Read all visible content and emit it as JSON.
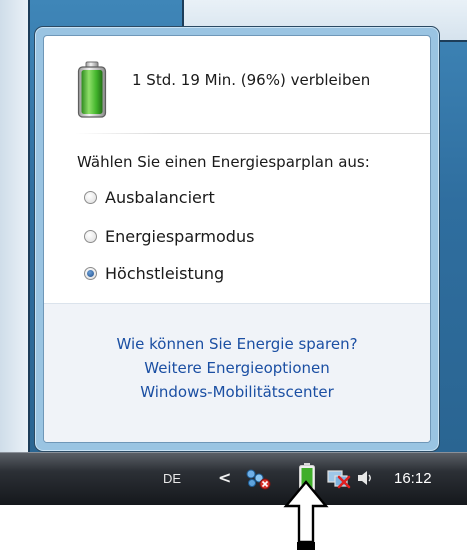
{
  "flyout": {
    "status_text": "1 Std. 19 Min. (96%) verbleiben",
    "battery_percent": 96,
    "plan_title": "Wählen Sie einen Energiesparplan aus:",
    "plans": [
      {
        "label": "Ausbalanciert",
        "selected": false
      },
      {
        "label": "Energiesparmodus",
        "selected": false
      },
      {
        "label": "Höchstleistung",
        "selected": true
      }
    ],
    "links": [
      "Wie können Sie Energie sparen?",
      "Weitere Energieoptionen",
      "Windows-Mobilitätscenter"
    ]
  },
  "taskbar": {
    "language": "DE",
    "chevron": "<",
    "clock": "16:12",
    "icons": [
      "network-icon",
      "battery-icon",
      "display-icon",
      "volume-icon"
    ]
  },
  "colors": {
    "link": "#1b4fa3",
    "battery_green": "#3fae2a",
    "taskbar": "#1e2227",
    "flyout_border": "#9ac4e2"
  }
}
